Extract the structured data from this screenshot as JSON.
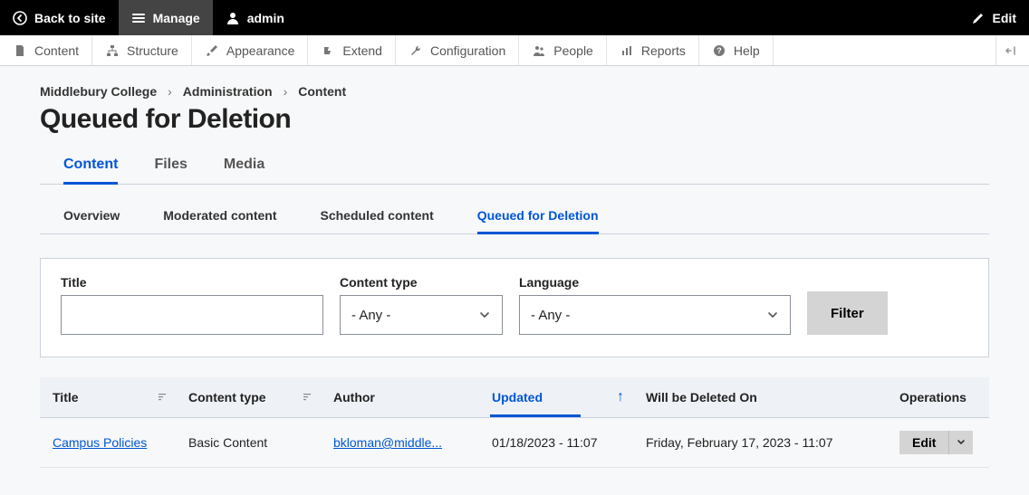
{
  "topbar": {
    "back": "Back to site",
    "manage": "Manage",
    "user": "admin",
    "edit": "Edit"
  },
  "toolbar": {
    "content": "Content",
    "structure": "Structure",
    "appearance": "Appearance",
    "extend": "Extend",
    "configuration": "Configuration",
    "people": "People",
    "reports": "Reports",
    "help": "Help"
  },
  "breadcrumb": {
    "items": [
      "Middlebury College",
      "Administration",
      "Content"
    ]
  },
  "page": {
    "title": "Queued for Deletion"
  },
  "tabs": {
    "content": "Content",
    "files": "Files",
    "media": "Media"
  },
  "subtabs": {
    "overview": "Overview",
    "moderated": "Moderated content",
    "scheduled": "Scheduled content",
    "queued": "Queued for Deletion"
  },
  "filters": {
    "title_label": "Title",
    "title_value": "",
    "content_type_label": "Content type",
    "content_type_value": "- Any -",
    "language_label": "Language",
    "language_value": "- Any -",
    "button": "Filter"
  },
  "table": {
    "headers": {
      "title": "Title",
      "content_type": "Content type",
      "author": "Author",
      "updated": "Updated",
      "deleted_on": "Will be Deleted On",
      "operations": "Operations"
    },
    "rows": [
      {
        "title": "Campus Policies",
        "content_type": "Basic Content",
        "author": "bkloman@middle...",
        "updated": "01/18/2023 - 11:07",
        "deleted_on": "Friday, February 17, 2023 - 11:07",
        "op": "Edit"
      }
    ]
  }
}
